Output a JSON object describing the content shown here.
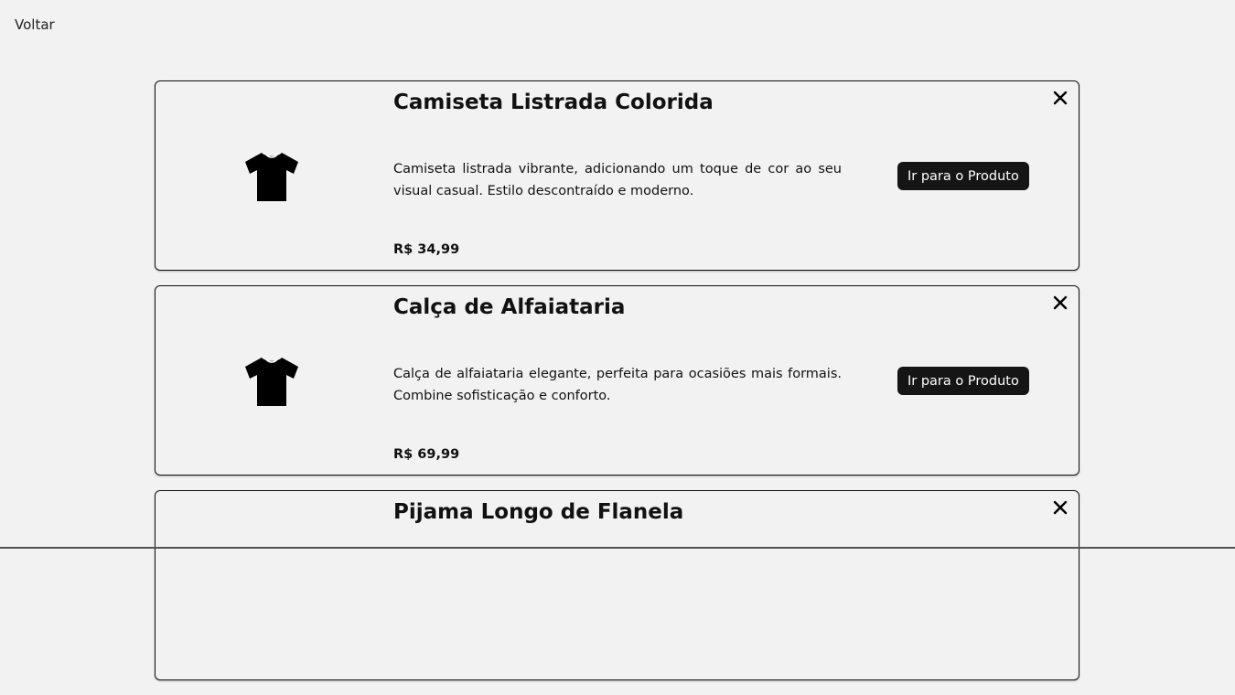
{
  "nav": {
    "back_label": "Voltar"
  },
  "products": [
    {
      "title": "Camiseta Listrada Colorida",
      "description": "Camiseta listrada vibrante, adicionando um toque de cor ao seu visual casual. Estilo descontraído e moderno.",
      "price": "R$ 34,99",
      "button_label": "Ir para o Produto",
      "icon": "tshirt-icon"
    },
    {
      "title": "Calça de Alfaiataria",
      "description": "Calça de alfaiataria elegante, perfeita para ocasiões mais formais. Combine sofisticação e conforto.",
      "price": "R$ 69,99",
      "button_label": "Ir para o Produto",
      "icon": "tshirt-icon"
    },
    {
      "title": "Pijama Longo de Flanela",
      "description": "",
      "price": "",
      "button_label": "",
      "icon": "tshirt-icon"
    }
  ],
  "colors": {
    "background": "#f2f2f2",
    "button": "#151515",
    "border": "#111111"
  }
}
